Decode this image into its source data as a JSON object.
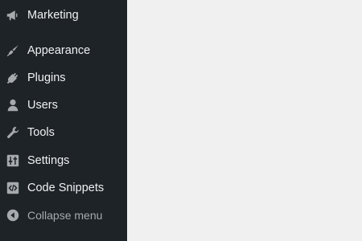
{
  "sidebar": {
    "items": [
      {
        "label": "Marketing",
        "icon": "megaphone-icon"
      },
      {
        "label": "Appearance",
        "icon": "paintbrush-icon"
      },
      {
        "label": "Plugins",
        "icon": "plug-icon"
      },
      {
        "label": "Users",
        "icon": "user-icon"
      },
      {
        "label": "Tools",
        "icon": "wrench-icon"
      },
      {
        "label": "Settings",
        "icon": "sliders-icon"
      },
      {
        "label": "Code Snippets",
        "icon": "code-icon"
      }
    ],
    "collapse": {
      "label": "Collapse menu",
      "icon": "collapse-arrow-icon"
    }
  },
  "colors": {
    "sidebar_bg": "#1d2327",
    "content_bg": "#f0f0f1",
    "label": "#f0f0f1",
    "icon": "#a7aaad"
  }
}
